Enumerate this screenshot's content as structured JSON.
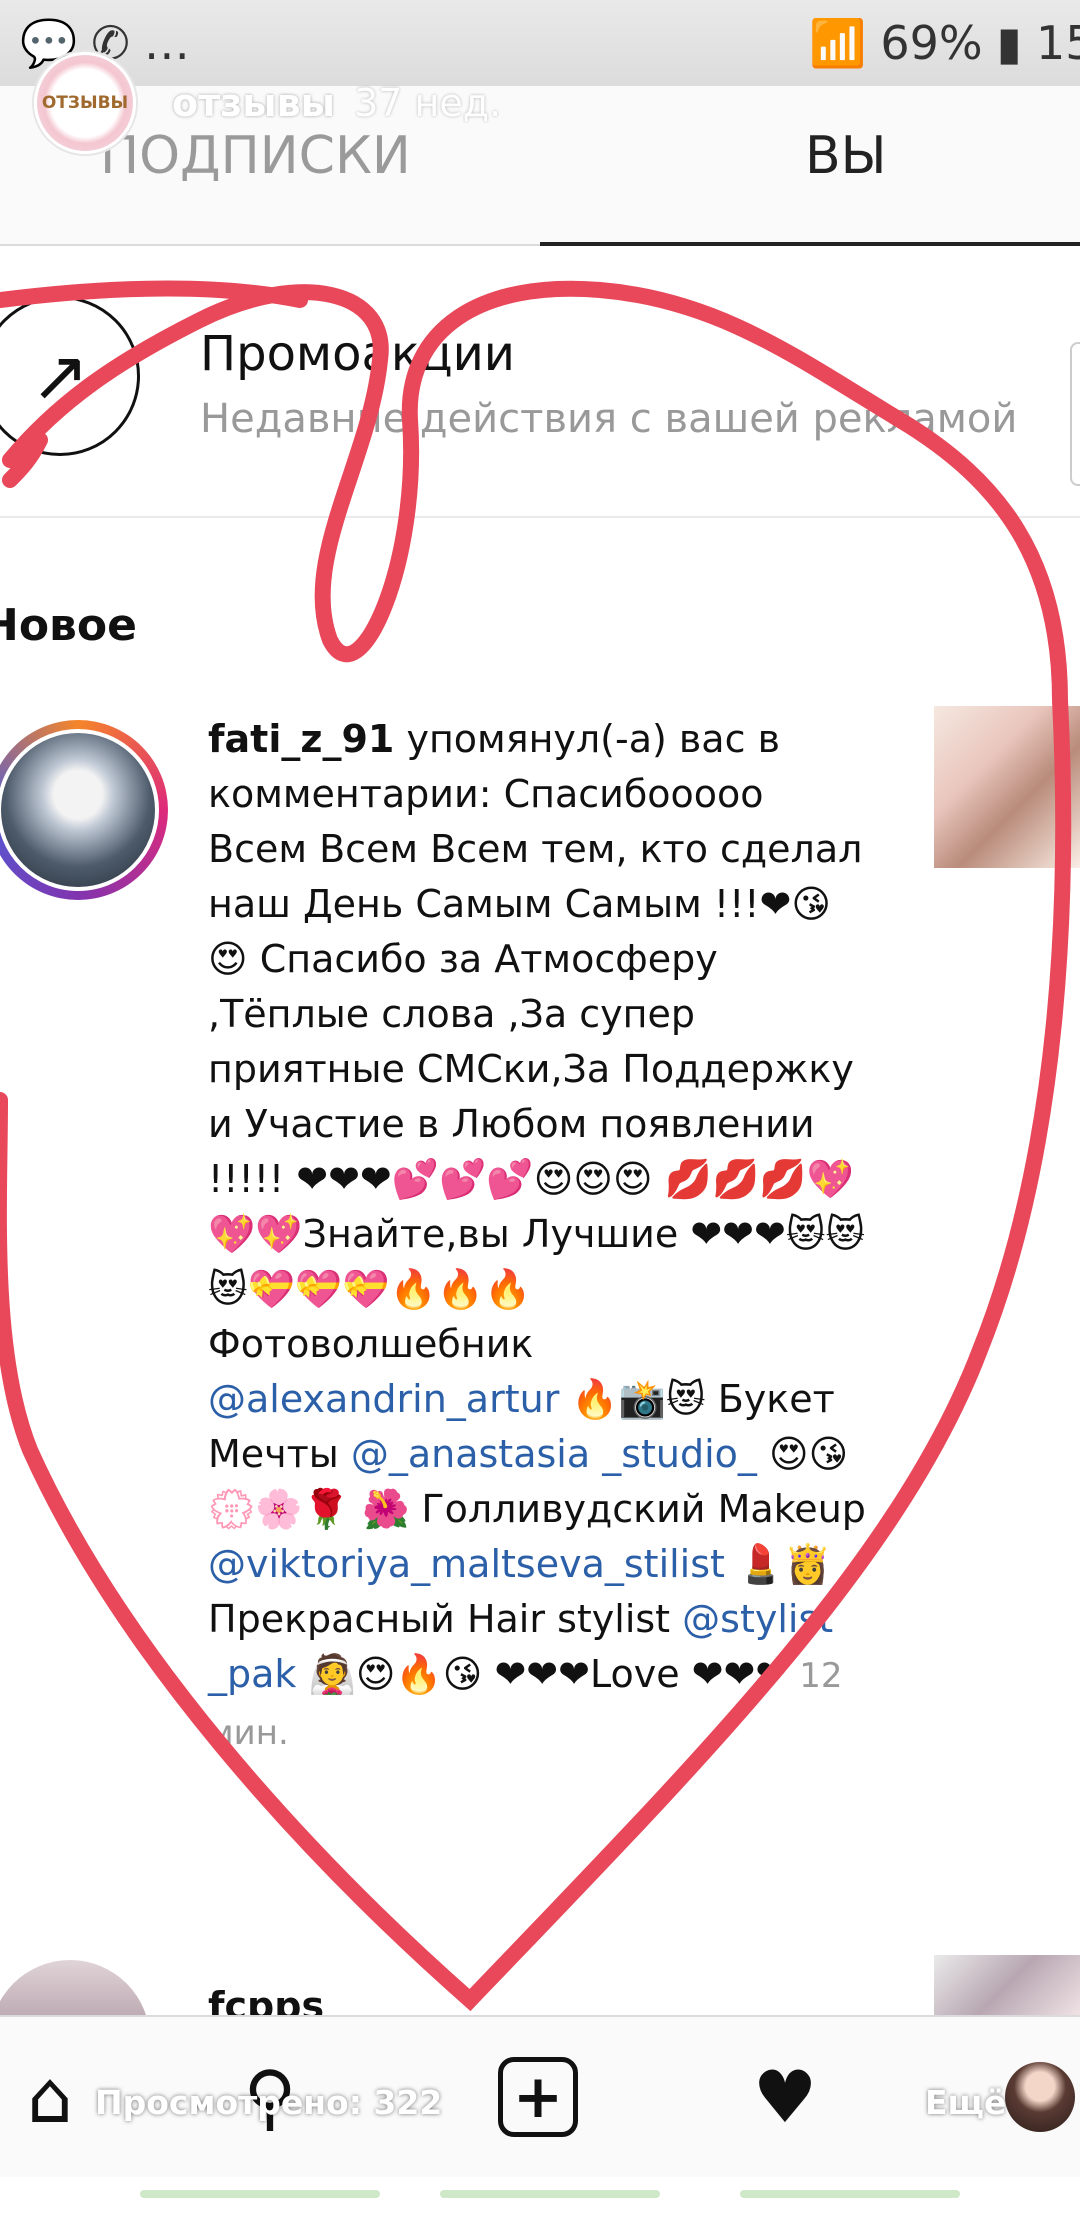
{
  "status": {
    "left_dots": "…",
    "battery": "69%",
    "clock": "15:"
  },
  "story": {
    "title": "отзывы",
    "age": "37 нед.",
    "avatar_text": "ОТЗЫВЫ"
  },
  "tabs": {
    "following": "ПОДПИСКИ",
    "you": "ВЫ"
  },
  "promotions": {
    "title": "Промоакции",
    "subtitle": "Недавние действия с вашей рекламой"
  },
  "section": {
    "new_label": "Новое"
  },
  "notification": {
    "username": "fati_z_91",
    "action": " упомянул(-а) вас в комментарии: ",
    "part1": "Спасибооооо Всем Всем Всем тем, кто сделал наш День Самым Самым !!!❤😘😍 Спасибо за Атмосферу ,Тёплые слова ,За супер приятные СМСки,За Поддержку и Участие в Любом появлении !!!!! ❤❤❤💕💕💕😍😍😍 💋💋💋💖💖💖Знайте,вы Лучшие ❤❤❤😻😻😻💝💝💝🔥🔥🔥 Фотоволшебник ",
    "mention1": "@alexandrin_artur",
    "part2": " 🔥📸😻 Букет Мечты ",
    "mention2": "@_anastasia _studio_",
    "part3": " 😍😘💮🌸🌹 🌺 Голливудский Makeup ",
    "mention3": "@viktoriya_maltseva_stilist",
    "part4": " 💄👸 Прекрасный Hair stylist ",
    "mention4": "@stylist _pak",
    "part5": " 👰😍🔥😘 ❤❤❤Love ❤❤❤ ",
    "time": "12 мин."
  },
  "notification2": {
    "username": "fcpps"
  },
  "bottom": {
    "viewed": "Просмотрено: 322",
    "more": "Ещё"
  },
  "icons": {
    "promo": "↗",
    "add": "+",
    "activity": "♥"
  },
  "colors": {
    "heart": "#e8485a",
    "mention": "#2b5fa8"
  }
}
